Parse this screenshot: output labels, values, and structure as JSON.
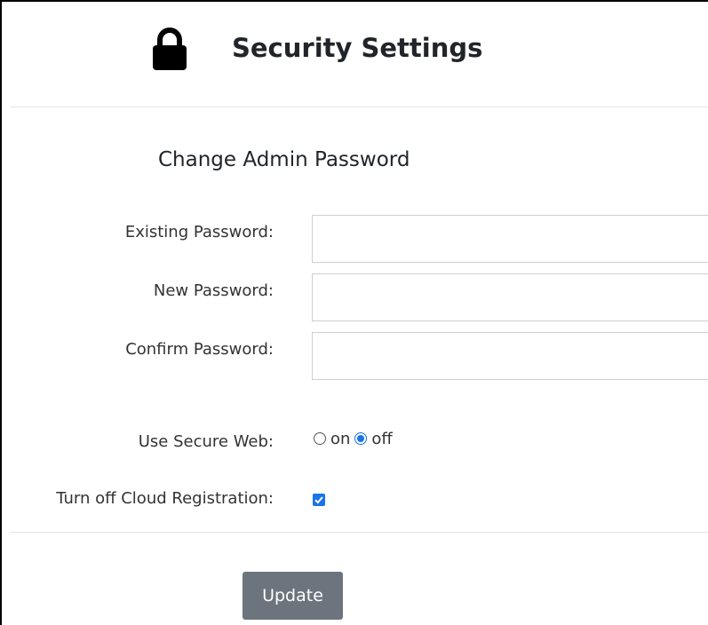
{
  "header": {
    "title": "Security Settings",
    "icon": "lock-icon"
  },
  "password_section": {
    "title": "Change Admin Password",
    "existing_label": "Existing Password:",
    "existing_value": "",
    "new_label": "New Password:",
    "new_value": "",
    "confirm_label": "Confirm Password:",
    "confirm_value": ""
  },
  "secure_web": {
    "label": "Use Secure Web:",
    "options": [
      "on",
      "off"
    ],
    "selected": "off"
  },
  "cloud_registration": {
    "label": "Turn off Cloud Registration:",
    "checked": true
  },
  "actions": {
    "update_label": "Update"
  },
  "colors": {
    "accent": "#1a73e8",
    "button_bg": "#6c757d",
    "text": "#212529"
  }
}
